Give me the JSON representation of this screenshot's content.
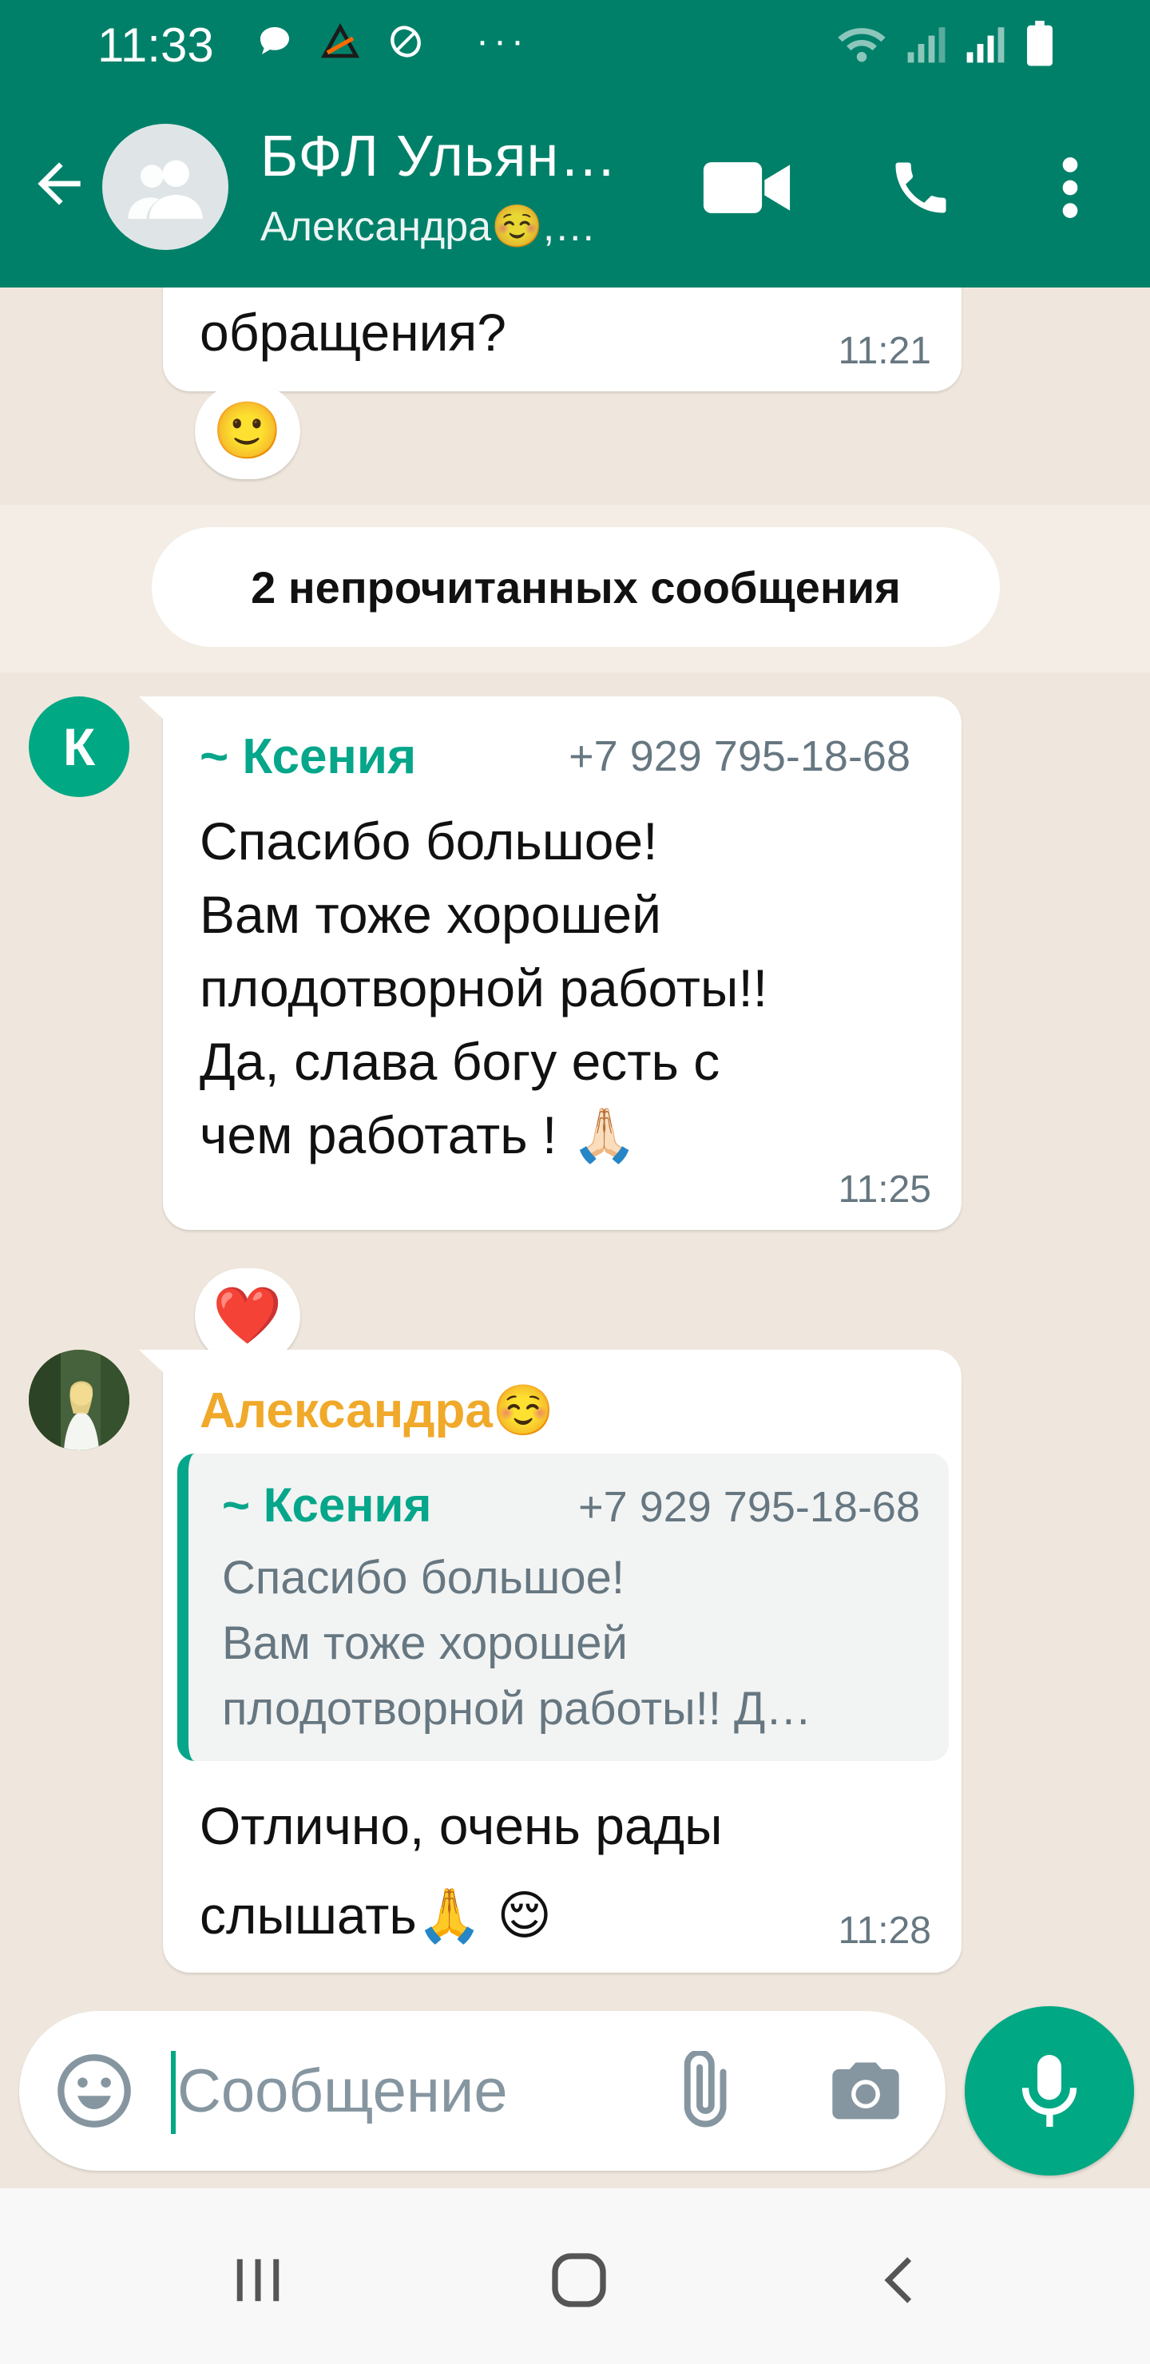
{
  "status_bar": {
    "time": "11:33",
    "dots": "···",
    "icons": [
      "chat-bubble-icon",
      "warning-app-icon",
      "leaf-icon",
      "wifi-icon",
      "signal-icon",
      "signal-icon",
      "battery-icon"
    ]
  },
  "header": {
    "title": "БФЛ Ульян…",
    "subtitle": "Александра☺️,…",
    "icons": [
      "back-arrow-icon",
      "group-avatar-icon",
      "video-call-icon",
      "phone-call-icon",
      "more-vert-icon"
    ]
  },
  "messages": [
    {
      "text": "обращения?",
      "time": "11:21",
      "reaction": "🙂"
    },
    {
      "sender": "~ Ксения",
      "avatar_letter": "К",
      "phone": "+7 929 795-18-68",
      "text": "Спасибо большое!\nВам тоже хорошей\nплодотворной работы!!\nДа, слава богу есть с\nчем работать ! 🙏🏻",
      "time": "11:25",
      "reaction": "❤️"
    },
    {
      "sender": "Александра☺️",
      "quote": {
        "sender": "~ Ксения",
        "phone": "+7 929 795-18-68",
        "text": "Спасибо большое!\nВам тоже хорошей\nплодотворной работы!! Д…"
      },
      "text": "Отлично, очень рады\nслышать🙏 😌",
      "time": "11:28"
    }
  ],
  "unread_divider": "2 непрочитанных сообщения",
  "composer": {
    "placeholder": "Сообщение"
  },
  "colors": {
    "header": "#008069",
    "accent": "#00a884",
    "quote_bar": "#06a68a",
    "alexandra_name": "#f0a92a",
    "chat_bg": "#efe7dd"
  }
}
